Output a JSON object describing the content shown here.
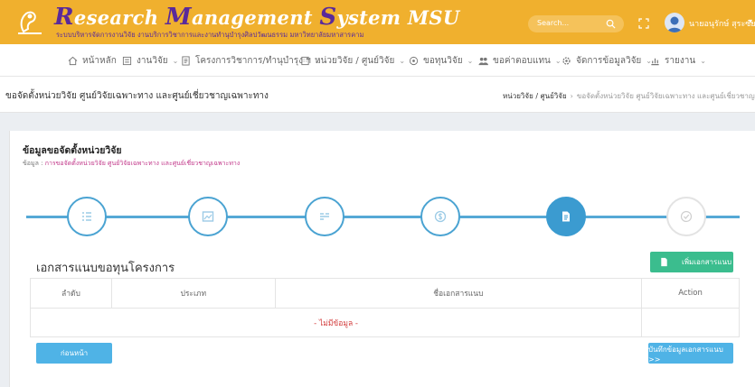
{
  "header": {
    "brand": {
      "R": "R",
      "esearch": "esearch ",
      "M": "M",
      "anagement": "anagement ",
      "S": "S",
      "ystem": "ystem MSU"
    },
    "subtitle": "ระบบบริหารจัดการงานวิจัย งานบริการวิชาการและงานทำนุบำรุงศิลปวัฒนธรรม มหาวิทยาลัยมหาสารคาม",
    "search_placeholder": "Search...",
    "user_name": "นายอนุรักษ์ สุระซัยดี"
  },
  "nav": {
    "items": [
      {
        "label": "หน้าหลัก",
        "icon": "home-icon",
        "has_caret": false
      },
      {
        "label": "งานวิจัย",
        "icon": "list-icon",
        "has_caret": true
      },
      {
        "label": "โครงการวิชาการ/ทำนุบำรุง ฯ",
        "icon": "doc-icon",
        "has_caret": true
      },
      {
        "label": "หน่วยวิจัย / ศูนย์วิจัย",
        "icon": "building-icon",
        "has_caret": true
      },
      {
        "label": "ขอทุนวิจัย",
        "icon": "coin-icon",
        "has_caret": true
      },
      {
        "label": "ขอค่าตอบแทน",
        "icon": "users-icon",
        "has_caret": true
      },
      {
        "label": "จัดการข้อมูลวิจัย",
        "icon": "gear-icon",
        "has_caret": true
      },
      {
        "label": "รายงาน",
        "icon": "report-icon",
        "has_caret": true
      }
    ]
  },
  "page": {
    "title": "ขอจัดตั้งหน่วยวิจัย ศูนย์วิจัยเฉพาะทาง และศูนย์เชี่ยวชาญเฉพาะทาง",
    "breadcrumb": [
      "หน่วยวิจัย / ศูนย์วิจัย",
      "ขอจัดตั้งหน่วยวิจัย ศูนย์วิจัยเฉพาะทาง และศูนย์เชี่ยวชาญเฉพาะทาง"
    ]
  },
  "card": {
    "title": "ข้อมูลขอจัดตั้งหน่วยวิจัย",
    "sub_label": "ข้อมูล : ",
    "sub_value": "การขอจัดตั้งหน่วยวิจัย ศูนย์วิจัยเฉพาะทาง และศูนย์เชี่ยวชาญเฉพาะทาง"
  },
  "stepper": {
    "current_step": 5,
    "steps": [
      {
        "icon": "list-icon"
      },
      {
        "icon": "image-icon"
      },
      {
        "icon": "list-alt-icon"
      },
      {
        "icon": "dollar-icon"
      },
      {
        "icon": "file-icon"
      },
      {
        "icon": "check-icon"
      }
    ]
  },
  "attachments": {
    "title": "เอกสารแนบขอทุนโครงการ",
    "add_button": "เพิ่มเอกสารแนบ",
    "columns": [
      "ลำดับ",
      "ประเภท",
      "ชื่อเอกสารแนบ",
      "Action"
    ],
    "empty_text": "- ไม่มีข้อมูล -"
  },
  "footer": {
    "back_button": "ก่อนหน้า",
    "save_button": "บันทึกข้อมูลเอกสารแนบ >>"
  },
  "colors": {
    "header": "#f0b02e",
    "accent": "#3b9bd0",
    "success": "#3bbd8e",
    "danger": "#d23a3a"
  }
}
